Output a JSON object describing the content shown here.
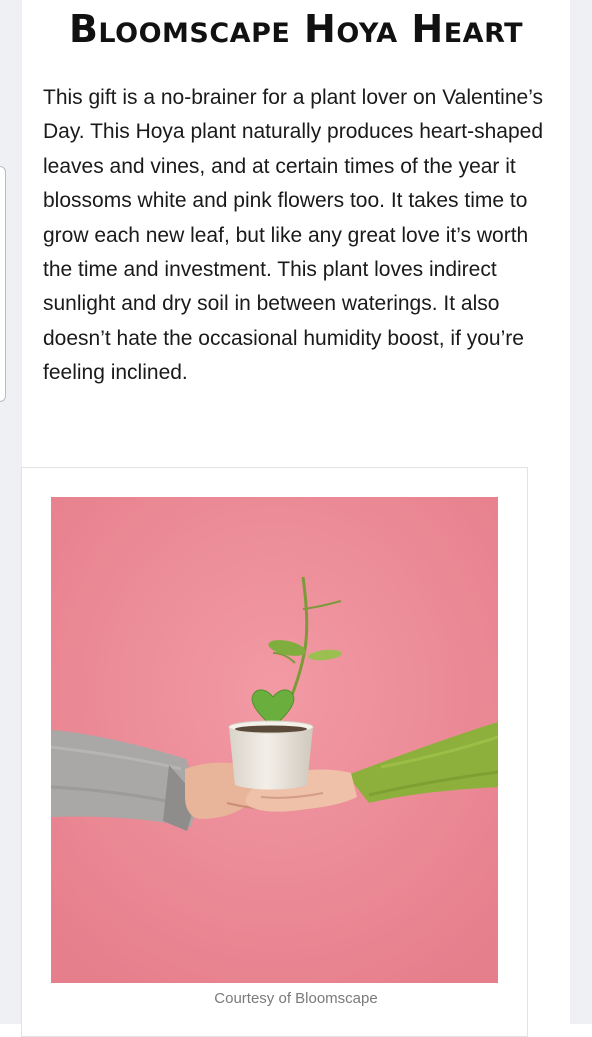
{
  "article": {
    "heading": "Bloomscape Hoya Heart",
    "body": "This gift is a no-brainer for a plant lover on Valentine’s Day. This Hoya plant naturally produces heart-shaped leaves and vines, and at certain times of the year it blossoms white and pink flowers too. It takes time to grow each new leaf, but like any great love it’s worth the time and investment. This plant loves indirect sunlight and dry soil in between waterings. It also doesn’t hate the occasional humidity boost, if you’re feeling inclined."
  },
  "figure": {
    "caption": "Courtesy of Bloomscape"
  },
  "colors": {
    "photo_background": "#ec8d98",
    "sweater_left": "#a7a6a5",
    "sleeve_right": "#8cae3a",
    "leaf": "#6fae3f",
    "pot": "#ece7df"
  }
}
